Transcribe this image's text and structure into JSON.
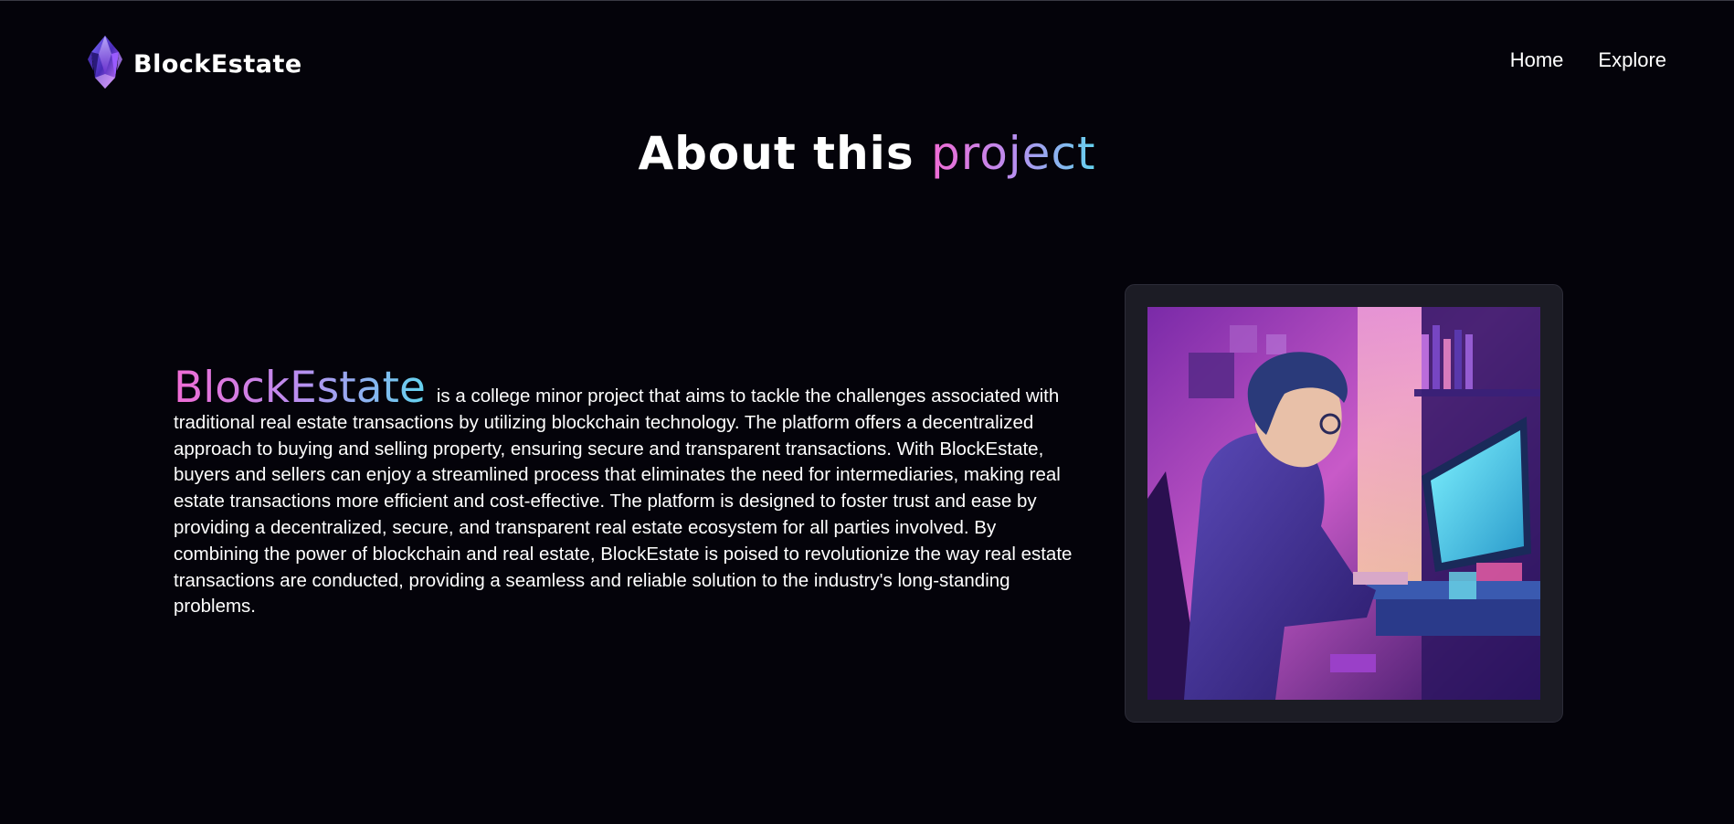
{
  "header": {
    "brand_name": "BlockEstate",
    "nav": [
      {
        "label": "Home"
      },
      {
        "label": "Explore"
      }
    ]
  },
  "hero": {
    "heading_main": "About this",
    "heading_accent": "project"
  },
  "about": {
    "highlight": "BlockEstate",
    "body": "is a college minor project that aims to tackle the challenges associated with traditional real estate transactions by utilizing blockchain technology. The platform offers a decentralized approach to buying and selling property, ensuring secure and transparent transactions. With BlockEstate, buyers and sellers can enjoy a streamlined process that eliminates the need for intermediaries, making real estate transactions more efficient and cost-effective. The platform is designed to foster trust and ease by providing a decentralized, secure, and transparent real estate ecosystem for all parties involved. By combining the power of blockchain and real estate, BlockEstate is poised to revolutionize the way real estate transactions are conducted, providing a seamless and reliable solution to the industry's long-standing problems."
  },
  "colors": {
    "background": "#04030a",
    "gradient_start": "#f06bd4",
    "gradient_mid": "#b98ef0",
    "gradient_end": "#63d3ef",
    "frame_bg": "#1c1c25"
  },
  "icons": {
    "logo": "crystal-logo-icon",
    "illustration": "developer-at-computer-illustration"
  }
}
